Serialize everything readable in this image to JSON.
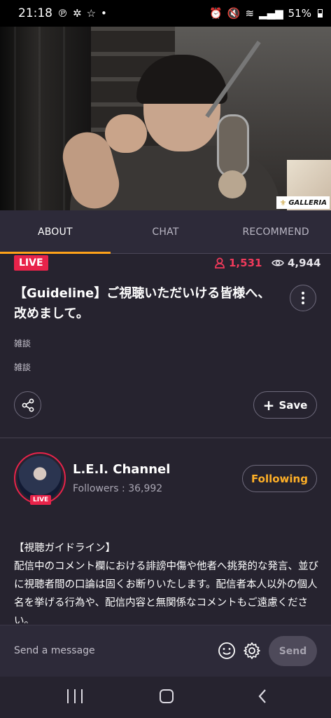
{
  "status_bar": {
    "time": "21:18",
    "left_icons": [
      "pinterest-icon",
      "app-icon",
      "star-icon",
      "dot-icon"
    ],
    "battery": "51%"
  },
  "video": {
    "overlay_brand": "GALLERIA"
  },
  "tabs": [
    {
      "label": "ABOUT",
      "active": true
    },
    {
      "label": "CHAT",
      "active": false
    },
    {
      "label": "RECOMMEND",
      "active": false
    }
  ],
  "about": {
    "live_label": "LIVE",
    "viewers": "1,531",
    "views": "4,944",
    "title": "【Guideline】ご視聴いただいける皆様へ、改めまして。",
    "tag1": "雑談",
    "tag2": "雑談",
    "save_label": "Save"
  },
  "channel": {
    "name": "L.E.I. Channel",
    "followers": "Followers : 36,992",
    "live_label": "LIVE",
    "follow_label": "Following"
  },
  "description": "【視聴ガイドライン】\n配信中のコメント欄における誹謗中傷や他者へ挑発的な発言、並びに視聴者間の口論は固くお断りいたします。配信者本人以外の個人名を挙げる行為や、配信内容と無関係なコメントもご遠慮ください。",
  "message_bar": {
    "placeholder": "Send a message",
    "send_label": "Send"
  },
  "colors": {
    "accent": "#ffa21a",
    "live_red": "#e8234a",
    "background": "#26232f"
  }
}
